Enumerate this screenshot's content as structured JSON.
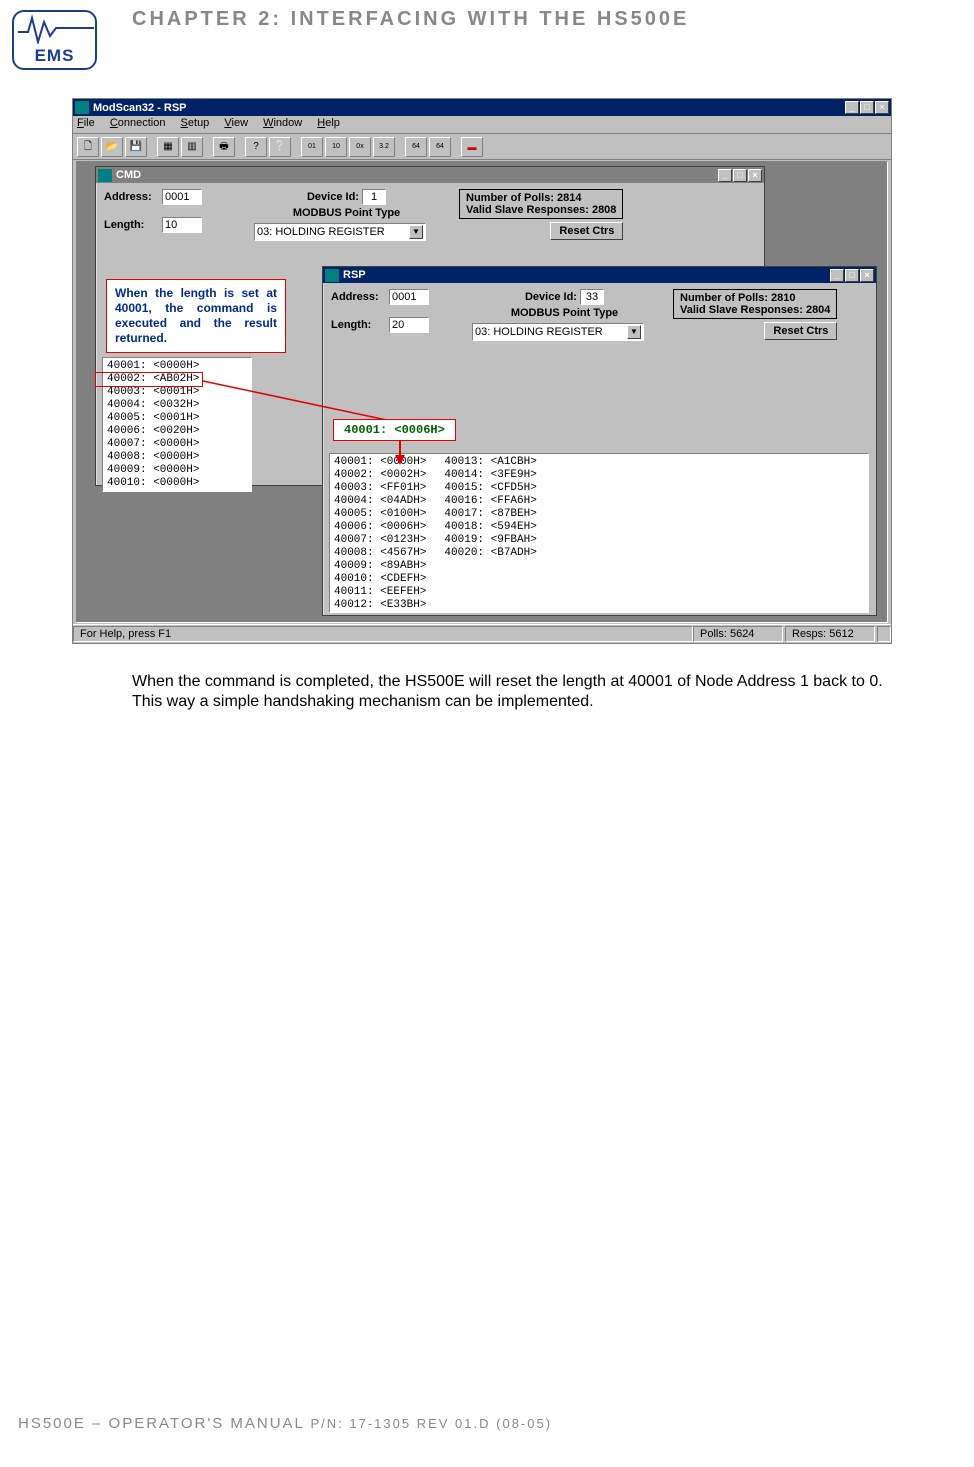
{
  "header": {
    "logo_text": "EMS",
    "chapter": "CHAPTER 2: INTERFACING WITH THE HS500E"
  },
  "app": {
    "title": "ModScan32 - RSP",
    "menu": [
      "File",
      "Connection",
      "Setup",
      "View",
      "Window",
      "Help"
    ],
    "status_left": "For Help, press F1",
    "status_polls": "Polls: 5624",
    "status_resps": "Resps: 5612"
  },
  "cmd": {
    "title": "CMD",
    "address_label": "Address:",
    "address_value": "0001",
    "length_label": "Length:",
    "length_value": "10",
    "device_label": "Device Id:",
    "device_value": "1",
    "point_type_label": "MODBUS Point Type",
    "point_type_value": "03: HOLDING REGISTER",
    "polls_line": "Number of Polls: 2814",
    "valid_line": "Valid Slave Responses: 2808",
    "reset_label": "Reset Ctrs",
    "registers": [
      "40001: <0000H>",
      "40002: <AB02H>",
      "40003: <0001H>",
      "40004: <0032H>",
      "40005: <0001H>",
      "40006: <0020H>",
      "40007: <0000H>",
      "40008: <0000H>",
      "40009: <0000H>",
      "40010: <0000H>"
    ]
  },
  "rsp": {
    "title": "RSP",
    "address_label": "Address:",
    "address_value": "0001",
    "length_label": "Length:",
    "length_value": "20",
    "device_label": "Device Id:",
    "device_value": "33",
    "point_type_label": "MODBUS Point Type",
    "point_type_value": "03: HOLDING REGISTER",
    "polls_line": "Number of Polls: 2810",
    "valid_line": "Valid Slave Responses: 2804",
    "reset_label": "Reset Ctrs",
    "registers_col1": [
      "40001: <0000H>",
      "40002: <0002H>",
      "40003: <FF01H>",
      "40004: <04ADH>",
      "40005: <0100H>",
      "40006: <0006H>",
      "40007: <0123H>",
      "40008: <4567H>",
      "40009: <89ABH>",
      "40010: <CDEFH>",
      "40011: <EEFEH>",
      "40012: <E33BH>"
    ],
    "registers_col2": [
      "40013: <A1CBH>",
      "40014: <3FE9H>",
      "40015: <CFD5H>",
      "40016: <FFA6H>",
      "40017: <87BEH>",
      "40018: <594EH>",
      "40019: <9FBAH>",
      "40020: <B7ADH>"
    ]
  },
  "annotations": {
    "note_text": "When the length is set at 40001, the command is executed and the result returned.",
    "callout_text": "40001: <0006H>"
  },
  "body": {
    "para": "When the command is completed, the HS500E will reset the length at 40001 of Node Address 1 back to 0. This way a simple handshaking mechanism can be implemented."
  },
  "footer": {
    "main": "HS500E – OPERATOR'S MANUAL ",
    "sub": "P/N: 17-1305 REV 01.D (08-05)"
  }
}
